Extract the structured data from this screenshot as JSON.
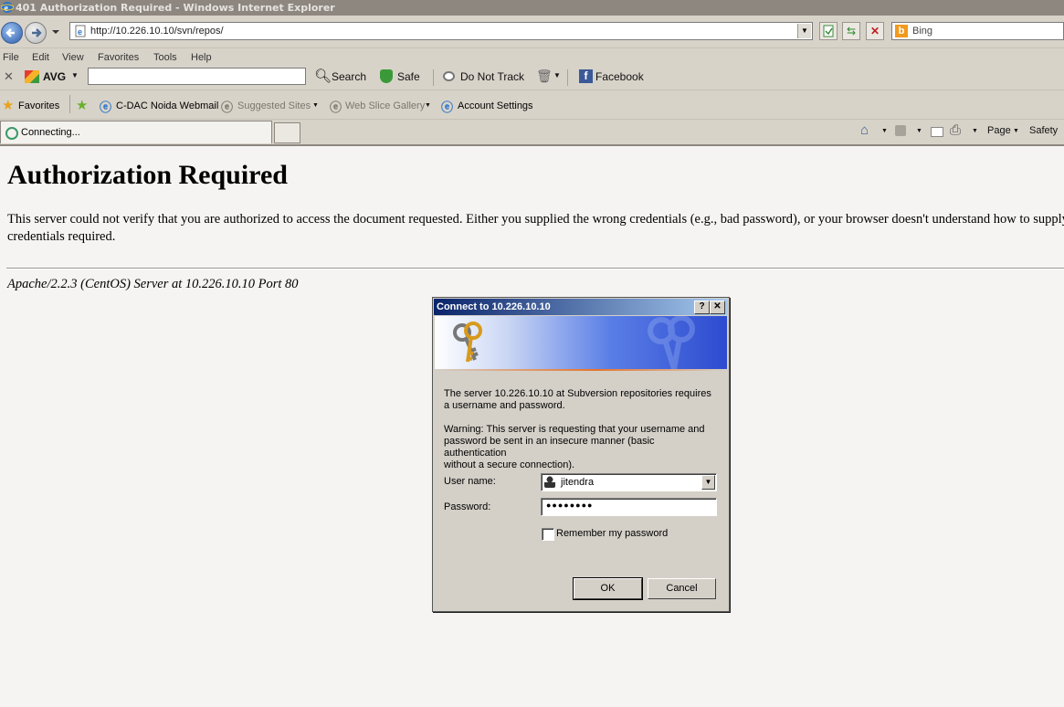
{
  "window": {
    "title": "401 Authorization Required - Windows Internet Explorer"
  },
  "address_bar": {
    "url": "http://10.226.10.10/svn/repos/"
  },
  "search_box": {
    "provider": "Bing"
  },
  "menu": {
    "items": [
      "File",
      "Edit",
      "View",
      "Favorites",
      "Tools",
      "Help"
    ]
  },
  "avg_toolbar": {
    "brand": "AVG",
    "search_label": "Search",
    "safe_label": "Safe",
    "dnt_label": "Do Not Track",
    "facebook_label": "Facebook"
  },
  "favorites_bar": {
    "favorites_label": "Favorites",
    "links": [
      "C-DAC Noida Webmail",
      "Suggested Sites",
      "Web Slice Gallery",
      "Account Settings"
    ]
  },
  "tab": {
    "label": "Connecting..."
  },
  "command_bar": {
    "page_label": "Page",
    "safety_label": "Safety"
  },
  "page": {
    "heading": "Authorization Required",
    "paragraph_line1": "This server could not verify that you are authorized to access the document requested. Either you supplied the wrong credentials (e.g., bad password), or your browser doesn't understand how to supply the",
    "paragraph_line2": "credentials required.",
    "server_signature": "Apache/2.2.3 (CentOS) Server at 10.226.10.10 Port 80"
  },
  "dialog": {
    "title": "Connect to 10.226.10.10",
    "help_label": "?",
    "close_label": "✕",
    "message_line1": "The server 10.226.10.10 at Subversion repositories requires",
    "message_line2": "a username and password.",
    "warning_line1": "Warning: This server is requesting that your username and",
    "warning_line2": "password be sent in an insecure manner (basic authentication",
    "warning_line3": "without a secure connection).",
    "username_label": "User name:",
    "username_value": "jitendra",
    "password_label": "Password:",
    "password_value": "●●●●●●●●",
    "remember_label": "Remember my password",
    "remember_checked": false,
    "ok_label": "OK",
    "cancel_label": "Cancel"
  }
}
